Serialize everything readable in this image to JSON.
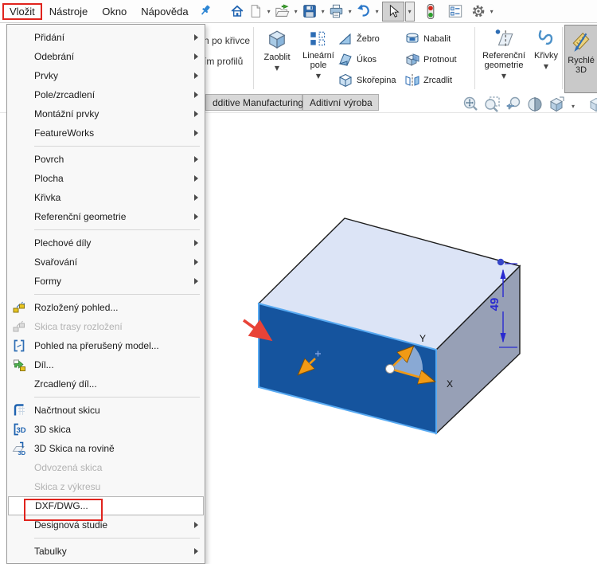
{
  "menubar": {
    "items": [
      {
        "label": "Vložit",
        "annotated": true
      },
      {
        "label": "Nástroje"
      },
      {
        "label": "Okno"
      },
      {
        "label": "Nápověda"
      }
    ],
    "pin_icon": "pin-icon",
    "toolbar_icons": [
      "home-icon",
      "new-document-icon",
      "open-icon",
      "save-icon",
      "print-icon",
      "undo-icon",
      "select-cursor-icon",
      "rebuild-traffic-light-icon",
      "design-tree-icon",
      "settings-gear-icon"
    ]
  },
  "ribbon": {
    "partial_labels": [
      "n po křivce",
      "ím profilů"
    ],
    "buttons": {
      "zaoblit": "Zaoblit",
      "linearni_pole": "Lineární pole",
      "zebro": "Žebro",
      "ukos": "Úkos",
      "skorepina": "Skořepina",
      "nabalit": "Nabalit",
      "protnout": "Protnout",
      "zrcadlit": "Zrcadlit",
      "referencni_geometrie": "Referenční geometrie",
      "krivky": "Křivky",
      "rychle_3d": "Rychlé 3D"
    }
  },
  "tabs": [
    {
      "label": "dditive Manufacturing"
    },
    {
      "label": "Aditivní výroba"
    }
  ],
  "headsup_icons": [
    "zoom-fit-icon",
    "zoom-area-icon",
    "previous-view-icon",
    "section-view-icon",
    "view-orientation-icon",
    "display-style-icon"
  ],
  "menu": {
    "title": "Vložit",
    "items": [
      {
        "label": "Přidání",
        "submenu": true
      },
      {
        "label": "Odebrání",
        "submenu": true
      },
      {
        "label": "Prvky",
        "submenu": true
      },
      {
        "label": "Pole/zrcadlení",
        "submenu": true
      },
      {
        "label": "Montážní prvky",
        "submenu": true
      },
      {
        "label": "FeatureWorks",
        "submenu": true
      },
      {
        "label": "Povrch",
        "submenu": true
      },
      {
        "label": "Plocha",
        "submenu": true
      },
      {
        "label": "Křivka",
        "submenu": true
      },
      {
        "label": "Referenční geometrie",
        "submenu": true
      },
      {
        "label": "Plechové díly",
        "submenu": true
      },
      {
        "label": "Svařování",
        "submenu": true
      },
      {
        "label": "Formy",
        "submenu": true
      },
      {
        "label": "Rozložený pohled...",
        "icon": "exploded-view-icon"
      },
      {
        "label": "Skica trasy rozložení",
        "icon": "exploded-sketch-icon",
        "disabled": true
      },
      {
        "label": "Pohled na přerušený model...",
        "icon": "broken-view-icon"
      },
      {
        "label": "Díl...",
        "icon": "insert-part-icon"
      },
      {
        "label": "Zrcadlený díl..."
      },
      {
        "label": "Načrtnout skicu",
        "icon": "sketch-icon"
      },
      {
        "label": "3D skica",
        "icon": "3d-sketch-icon"
      },
      {
        "label": "3D Skica na rovině",
        "icon": "3d-sketch-plane-icon"
      },
      {
        "label": "Odvozená skica",
        "disabled": true
      },
      {
        "label": "Skica z výkresu",
        "disabled": true
      },
      {
        "label": "DXF/DWG...",
        "highlighted": true,
        "annotated": true
      },
      {
        "label": "Designová studie",
        "submenu": true
      },
      {
        "label": "Tabulky",
        "submenu": true
      }
    ]
  },
  "viewport": {
    "dimension_value": "49",
    "axis_x_label": "X",
    "axis_y_label": "Y",
    "annotations": [
      "pointer-red-arrow",
      "direction-orange-arrow",
      "coordinate-triad",
      "height-dimension"
    ],
    "colors": {
      "top_face": "#dce4f6",
      "front_face": "#15549e",
      "side_face": "#97a0b6",
      "selection_edge": "#58aaf2",
      "dimension_blue": "#2a2ad0",
      "triad_orange": "#f19a15",
      "pointer_red": "#e84338"
    }
  },
  "annotation_color": "#e0231d"
}
